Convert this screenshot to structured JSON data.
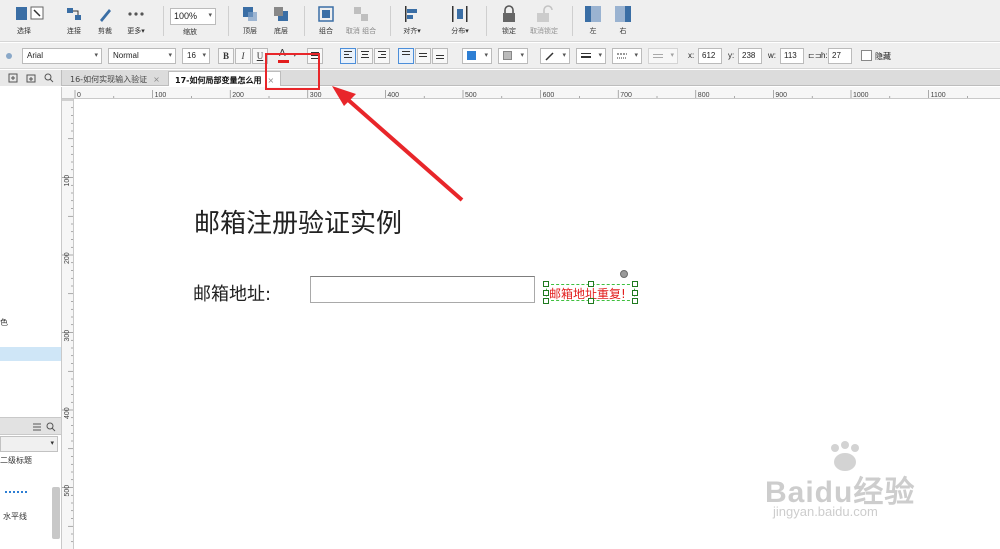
{
  "toolbar": {
    "select_label": "选择",
    "connect_label": "连接",
    "cut_label": "剪裁",
    "more_label": "更多▾",
    "zoom_value": "100%",
    "zoom_label": "缩放",
    "top_label": "顶层",
    "bottom_label": "底层",
    "group_label": "组合",
    "ungroup_label": "取消 组合",
    "align_label": "对齐▾",
    "distribute_label": "分布▾",
    "lock_label": "锁定",
    "unlock_label": "取消锁定",
    "left_label": "左",
    "right_label": "右"
  },
  "format": {
    "font_family": "Arial",
    "font_style": "Normal",
    "font_size": "16",
    "bold": "B",
    "italic": "I",
    "underline": "U",
    "font_color": "A",
    "x_label": "x:",
    "x_value": "612",
    "y_label": "y:",
    "y_value": "238",
    "w_label": "w:",
    "w_value": "113",
    "h_label": "h:",
    "h_value": "27",
    "hidden_label": "隐藏"
  },
  "tabs": [
    {
      "label": "16-如何实现输入验证",
      "close": "×"
    },
    {
      "label": "17-如何局部变量怎么用",
      "close": "×"
    }
  ],
  "left_panel": {
    "color_fragment": "色",
    "item_fragment": "二级标题",
    "hline_label": "水平线"
  },
  "ruler": {
    "top_ticks": [
      "0",
      "100",
      "200",
      "300",
      "400",
      "500",
      "600",
      "700",
      "800",
      "900",
      "1000",
      "1100"
    ],
    "left_ticks": [
      "100",
      "200",
      "300",
      "400",
      "500"
    ]
  },
  "canvas": {
    "title": "邮箱注册验证实例",
    "email_label": "邮箱地址:",
    "email_value": "",
    "error_text": "邮箱地址重复!"
  },
  "watermark": {
    "main": "Baidu经验",
    "sub": "jingyan.baidu.com"
  },
  "colors": {
    "accent_red": "#e8262a",
    "error_red": "#e21d1d",
    "selection_green": "#3fbf3f",
    "highlight_blue": "#cfe6f7"
  }
}
